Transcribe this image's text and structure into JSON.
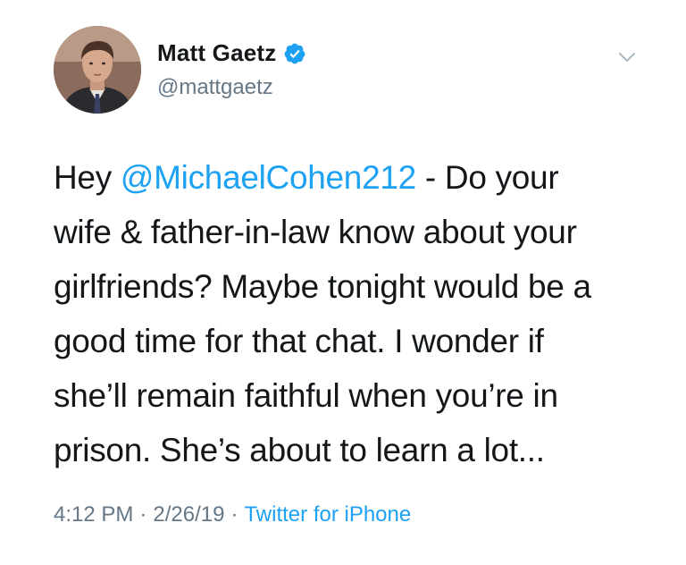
{
  "user": {
    "display_name": "Matt Gaetz",
    "handle": "@mattgaetz",
    "verified": true,
    "avatar_icon": "profile-photo"
  },
  "tweet": {
    "prefix": "Hey ",
    "mention": "@MichaelCohen212",
    "rest_line1": " - Do your",
    "line2": "wife & father-in-law know about your",
    "line3": "girlfriends? Maybe tonight would be a",
    "line4": "good time for that chat. I wonder if",
    "line5": "she’ll remain faithful when you’re in",
    "line6": "prison.  She’s about to learn a lot..."
  },
  "meta": {
    "time": "4:12 PM",
    "separator": "·",
    "date": "2/26/19",
    "source": "Twitter for iPhone"
  },
  "colors": {
    "link": "#1da1f2",
    "secondary": "#657786",
    "text": "#14171a"
  },
  "icons": {
    "verified": "verified-badge-icon",
    "menu": "chevron-down-icon"
  }
}
